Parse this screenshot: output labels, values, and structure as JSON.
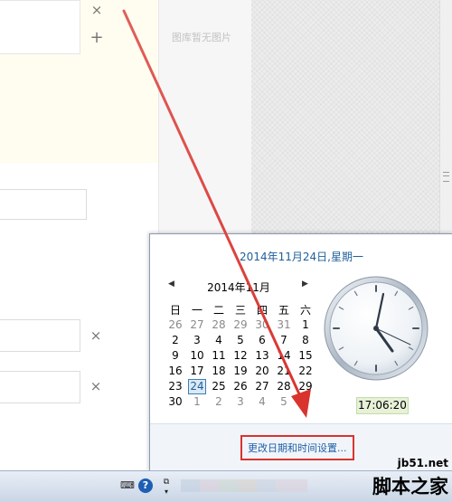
{
  "editor": {
    "close_icon": "×",
    "add_icon": "+"
  },
  "gallery": {
    "empty_text": "图库暂无图片"
  },
  "popup": {
    "date_header": "2014年11月24日,星期一",
    "month_title": "2014年11月",
    "weekdays": [
      "日",
      "一",
      "二",
      "三",
      "四",
      "五",
      "六"
    ],
    "rows": [
      [
        "26",
        "27",
        "28",
        "29",
        "30",
        "31",
        "1"
      ],
      [
        "2",
        "3",
        "4",
        "5",
        "6",
        "7",
        "8"
      ],
      [
        "9",
        "10",
        "11",
        "12",
        "13",
        "14",
        "15"
      ],
      [
        "16",
        "17",
        "18",
        "19",
        "20",
        "21",
        "22"
      ],
      [
        "23",
        "24",
        "25",
        "26",
        "27",
        "28",
        "29"
      ],
      [
        "30",
        "1",
        "2",
        "3",
        "4",
        "5",
        "6"
      ]
    ],
    "today": "24",
    "time": "17:06:20",
    "settings_link": "更改日期和时间设置..."
  },
  "watermark": {
    "site": "jb51.net",
    "name": "脚本之家"
  },
  "colors": {
    "accent_blue": "#1e5e9c",
    "annotation_red": "#d9332e",
    "time_bg": "#e6f1d8"
  }
}
